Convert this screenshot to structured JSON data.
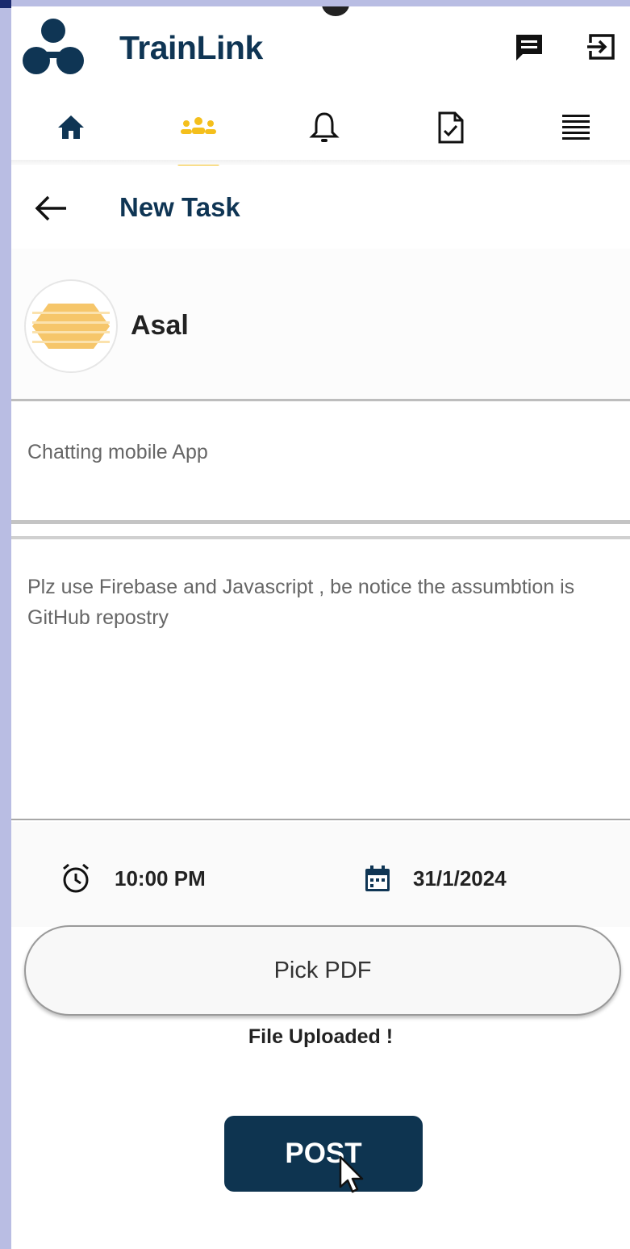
{
  "app": {
    "title": "TrainLink"
  },
  "header": {
    "icons": [
      "chat-icon",
      "logout-icon"
    ]
  },
  "nav": {
    "items": [
      "home-icon",
      "community-icon",
      "bell-icon",
      "task-file-icon",
      "menu-lines-icon"
    ],
    "active": "community-icon"
  },
  "page": {
    "title": "New Task"
  },
  "user": {
    "name": "Asal"
  },
  "task": {
    "title": "Chatting mobile App",
    "description": "Plz use Firebase and Javascript , be notice the assumbtion is GitHub repostry",
    "time": "10:00 PM",
    "date": "31/1/2024"
  },
  "buttons": {
    "pick_pdf": "Pick PDF",
    "post": "POST"
  },
  "status": {
    "upload": "File Uploaded !"
  },
  "colors": {
    "primary": "#0e3450",
    "accent": "#f4bf1c"
  }
}
